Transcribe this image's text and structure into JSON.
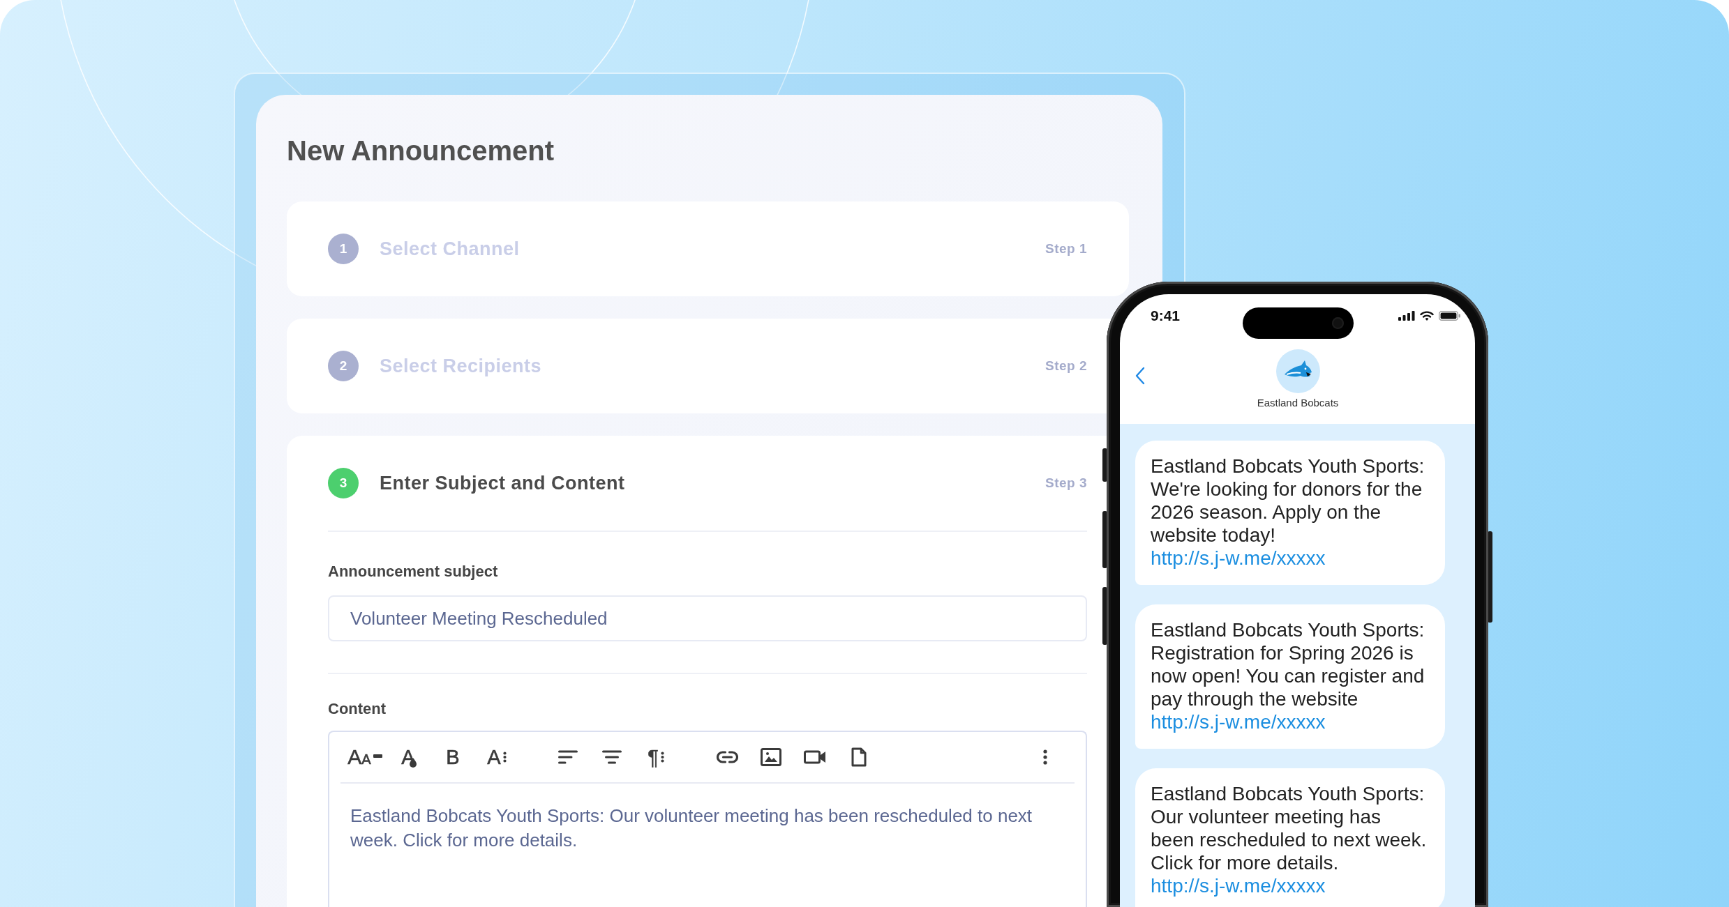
{
  "form": {
    "title": "New Announcement",
    "steps": [
      {
        "number": "1",
        "title": "Select Channel",
        "step_label": "Step 1",
        "active": false
      },
      {
        "number": "2",
        "title": "Select Recipients",
        "step_label": "Step 2",
        "active": false
      },
      {
        "number": "3",
        "title": "Enter Subject and Content",
        "step_label": "Step 3",
        "active": true,
        "subject": {
          "label": "Announcement subject",
          "value": "Volunteer Meeting Rescheduled"
        },
        "content": {
          "label": "Content",
          "toolbar_groups": [
            {
              "items": [
                {
                  "kind": "font-size",
                  "glyph": "AA"
                },
                {
                  "kind": "text-color",
                  "glyph": "A"
                },
                {
                  "kind": "bold",
                  "glyph": "B"
                },
                {
                  "kind": "text-style",
                  "glyph": "A"
                }
              ]
            },
            {
              "items": [
                {
                  "kind": "align-left"
                },
                {
                  "kind": "align-center"
                },
                {
                  "kind": "paragraph",
                  "glyph": "¶"
                }
              ]
            },
            {
              "items": [
                {
                  "kind": "link"
                },
                {
                  "kind": "image"
                },
                {
                  "kind": "video"
                },
                {
                  "kind": "file"
                }
              ]
            },
            {
              "items": [
                {
                  "kind": "more"
                }
              ]
            }
          ],
          "value": "Eastland Bobcats Youth Sports: Our volunteer meeting has been rescheduled to next week. Click for more details."
        }
      }
    ]
  },
  "phone": {
    "status_time": "9:41",
    "contact_name": "Eastland Bobcats",
    "messages": [
      {
        "text": "Eastland Bobcats Youth Sports: We're looking for donors for the 2026 season. Apply on the website today!",
        "link": "http://s.j-w.me/xxxxx"
      },
      {
        "text": "Eastland Bobcats Youth Sports: Registration for Spring 2026 is now open! You can register and pay through the website",
        "link": "http://s.j-w.me/xxxxx"
      },
      {
        "text": "Eastland Bobcats Youth Sports: Our volunteer meeting has been rescheduled to next week. Click for more details.",
        "link": "http://s.j-w.me/xxxxx"
      }
    ]
  }
}
